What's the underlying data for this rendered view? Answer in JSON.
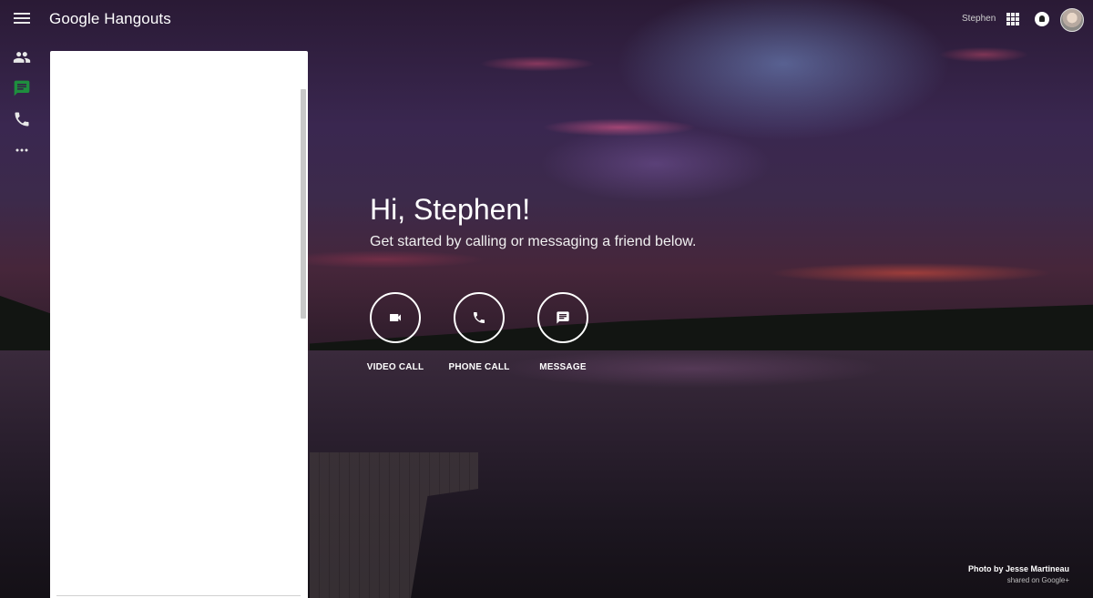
{
  "app": {
    "title": "Google Hangouts"
  },
  "header": {
    "user_name": "Stephen"
  },
  "icons": {
    "menu": "menu-icon",
    "apps": "apps-grid-icon",
    "notifications": "notifications-icon",
    "avatar": "avatar"
  },
  "rail": {
    "items": [
      {
        "icon": "people-icon"
      },
      {
        "icon": "chat-icon",
        "color": "#1e8e3e"
      },
      {
        "icon": "phone-icon"
      },
      {
        "icon": "more-icon"
      }
    ]
  },
  "main": {
    "greeting": "Hi, Stephen!",
    "subtitle": "Get started by calling or messaging a friend below.",
    "actions": [
      {
        "label": "VIDEO CALL",
        "icon": "videocam-icon"
      },
      {
        "label": "PHONE CALL",
        "icon": "phone-icon"
      },
      {
        "label": "MESSAGE",
        "icon": "message-icon"
      }
    ]
  },
  "credit": {
    "line1": "Photo by Jesse Martineau",
    "line2": "shared on Google+"
  },
  "colors": {
    "accent_green": "#1e8e3e"
  }
}
